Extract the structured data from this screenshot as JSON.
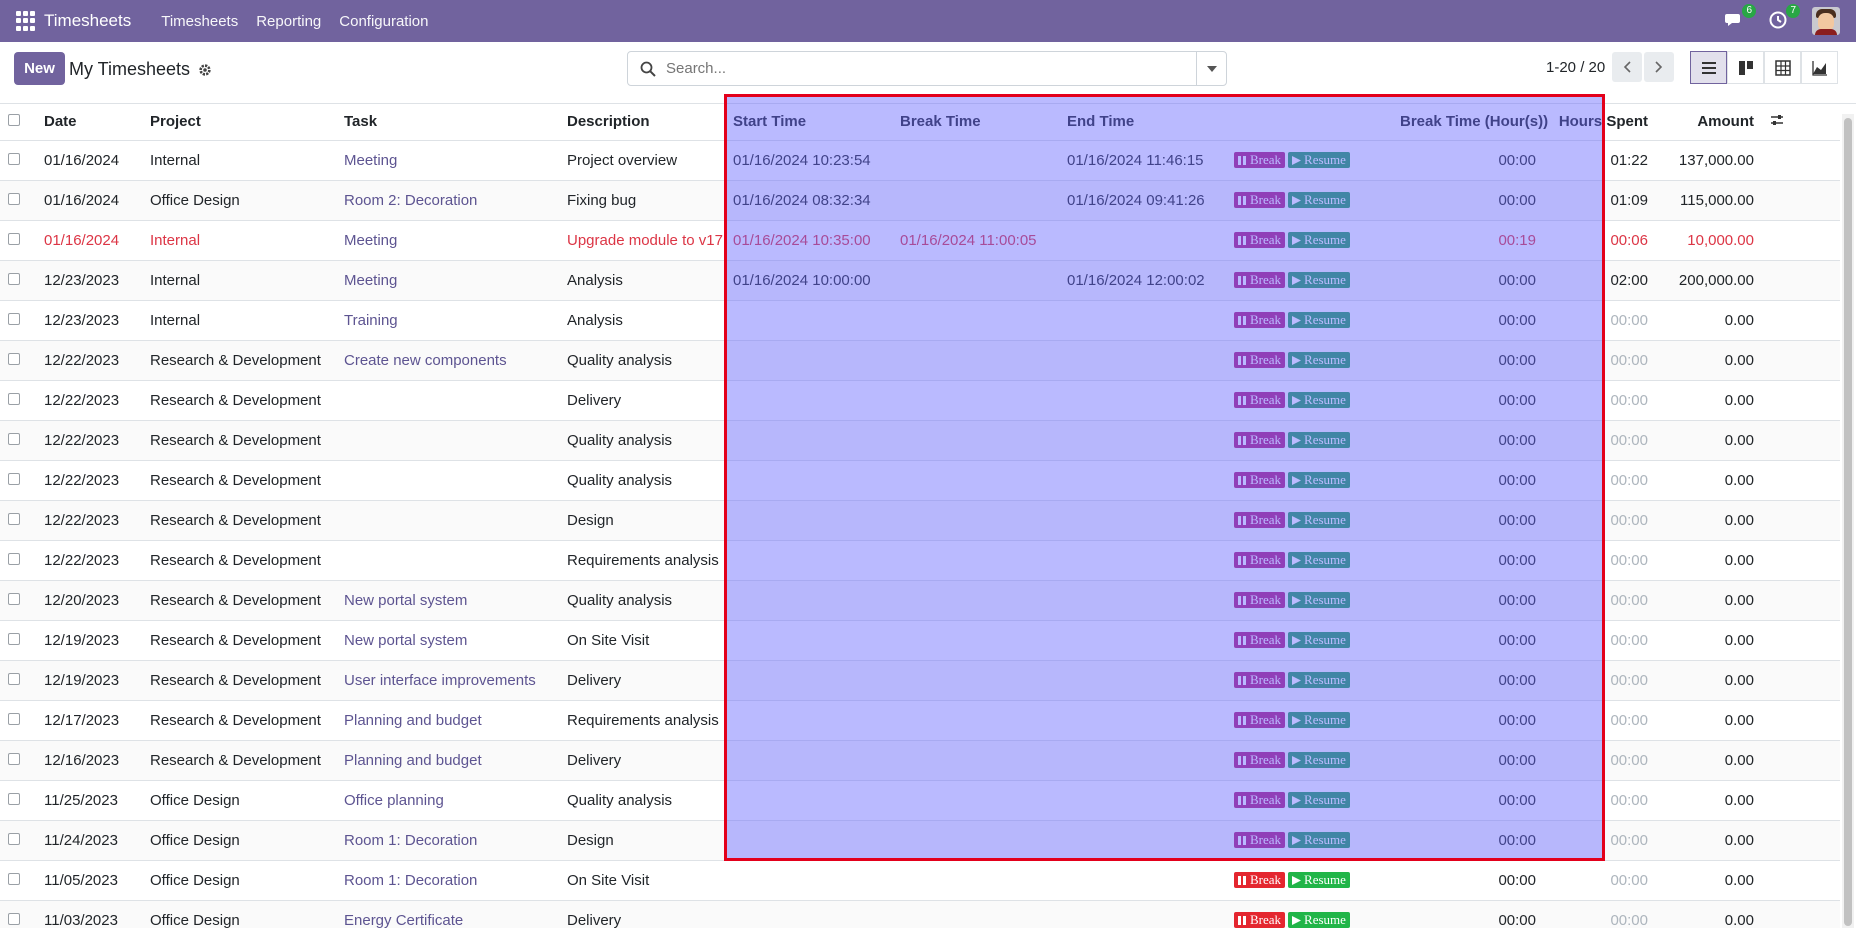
{
  "app": {
    "brand": "Timesheets",
    "menu": [
      "Timesheets",
      "Reporting",
      "Configuration"
    ],
    "messages_count": "6",
    "activities_count": "7"
  },
  "control": {
    "new_label": "New",
    "breadcrumb": "My Timesheets",
    "search_placeholder": "Search...",
    "pager": "1-20 / 20"
  },
  "table": {
    "headers": {
      "date": "Date",
      "project": "Project",
      "task": "Task",
      "description": "Description",
      "start_time": "Start Time",
      "break_time": "Break Time",
      "end_time": "End Time",
      "break_hours": "Break Time (Hour(s))",
      "hours_spent": "Hours Spent",
      "amount": "Amount"
    },
    "button_labels": {
      "break": "Break",
      "resume": "Resume"
    },
    "rows": [
      {
        "date": "01/16/2024",
        "project": "Internal",
        "task": "Meeting",
        "description": "Project overview",
        "start": "01/16/2024 10:23:54",
        "break": "",
        "end": "01/16/2024 11:46:15",
        "break_hours": "00:00",
        "hours": "01:22",
        "amount": "137,000.00"
      },
      {
        "date": "01/16/2024",
        "project": "Office Design",
        "task": "Room 2: Decoration",
        "description": "Fixing bug",
        "start": "01/16/2024 08:32:34",
        "break": "",
        "end": "01/16/2024 09:41:26",
        "break_hours": "00:00",
        "hours": "01:09",
        "amount": "115,000.00"
      },
      {
        "date": "01/16/2024",
        "project": "Internal",
        "task": "Meeting",
        "description": "Upgrade module to v17",
        "start": "01/16/2024 10:35:00",
        "break": "01/16/2024 11:00:05",
        "end": "",
        "break_hours": "00:19",
        "hours": "00:06",
        "amount": "10,000.00",
        "danger": true
      },
      {
        "date": "12/23/2023",
        "project": "Internal",
        "task": "Meeting",
        "description": "Analysis",
        "start": "01/16/2024 10:00:00",
        "break": "",
        "end": "01/16/2024 12:00:02",
        "break_hours": "00:00",
        "hours": "02:00",
        "amount": "200,000.00"
      },
      {
        "date": "12/23/2023",
        "project": "Internal",
        "task": "Training",
        "description": "Analysis",
        "start": "",
        "break": "",
        "end": "",
        "break_hours": "00:00",
        "hours": "00:00",
        "amount": "0.00",
        "zero": true
      },
      {
        "date": "12/22/2023",
        "project": "Research & Development",
        "task": "Create new components",
        "description": "Quality analysis",
        "start": "",
        "break": "",
        "end": "",
        "break_hours": "00:00",
        "hours": "00:00",
        "amount": "0.00",
        "zero": true
      },
      {
        "date": "12/22/2023",
        "project": "Research & Development",
        "task": "",
        "description": "Delivery",
        "start": "",
        "break": "",
        "end": "",
        "break_hours": "00:00",
        "hours": "00:00",
        "amount": "0.00",
        "zero": true
      },
      {
        "date": "12/22/2023",
        "project": "Research & Development",
        "task": "",
        "description": "Quality analysis",
        "start": "",
        "break": "",
        "end": "",
        "break_hours": "00:00",
        "hours": "00:00",
        "amount": "0.00",
        "zero": true
      },
      {
        "date": "12/22/2023",
        "project": "Research & Development",
        "task": "",
        "description": "Quality analysis",
        "start": "",
        "break": "",
        "end": "",
        "break_hours": "00:00",
        "hours": "00:00",
        "amount": "0.00",
        "zero": true
      },
      {
        "date": "12/22/2023",
        "project": "Research & Development",
        "task": "",
        "description": "Design",
        "start": "",
        "break": "",
        "end": "",
        "break_hours": "00:00",
        "hours": "00:00",
        "amount": "0.00",
        "zero": true
      },
      {
        "date": "12/22/2023",
        "project": "Research & Development",
        "task": "",
        "description": "Requirements analysis",
        "start": "",
        "break": "",
        "end": "",
        "break_hours": "00:00",
        "hours": "00:00",
        "amount": "0.00",
        "zero": true
      },
      {
        "date": "12/20/2023",
        "project": "Research & Development",
        "task": "New portal system",
        "description": "Quality analysis",
        "start": "",
        "break": "",
        "end": "",
        "break_hours": "00:00",
        "hours": "00:00",
        "amount": "0.00",
        "zero": true
      },
      {
        "date": "12/19/2023",
        "project": "Research & Development",
        "task": "New portal system",
        "description": "On Site Visit",
        "start": "",
        "break": "",
        "end": "",
        "break_hours": "00:00",
        "hours": "00:00",
        "amount": "0.00",
        "zero": true
      },
      {
        "date": "12/19/2023",
        "project": "Research & Development",
        "task": "User interface improvements",
        "description": "Delivery",
        "start": "",
        "break": "",
        "end": "",
        "break_hours": "00:00",
        "hours": "00:00",
        "amount": "0.00",
        "zero": true
      },
      {
        "date": "12/17/2023",
        "project": "Research & Development",
        "task": "Planning and budget",
        "description": "Requirements analysis",
        "start": "",
        "break": "",
        "end": "",
        "break_hours": "00:00",
        "hours": "00:00",
        "amount": "0.00",
        "zero": true
      },
      {
        "date": "12/16/2023",
        "project": "Research & Development",
        "task": "Planning and budget",
        "description": "Delivery",
        "start": "",
        "break": "",
        "end": "",
        "break_hours": "00:00",
        "hours": "00:00",
        "amount": "0.00",
        "zero": true
      },
      {
        "date": "11/25/2023",
        "project": "Office Design",
        "task": "Office planning",
        "description": "Quality analysis",
        "start": "",
        "break": "",
        "end": "",
        "break_hours": "00:00",
        "hours": "00:00",
        "amount": "0.00",
        "zero": true
      },
      {
        "date": "11/24/2023",
        "project": "Office Design",
        "task": "Room 1: Decoration",
        "description": "Design",
        "start": "",
        "break": "",
        "end": "",
        "break_hours": "00:00",
        "hours": "00:00",
        "amount": "0.00",
        "zero": true
      },
      {
        "date": "11/05/2023",
        "project": "Office Design",
        "task": "Room 1: Decoration",
        "description": "On Site Visit",
        "start": "",
        "break": "",
        "end": "",
        "break_hours": "00:00",
        "hours": "00:00",
        "amount": "0.00",
        "zero": true
      },
      {
        "date": "11/03/2023",
        "project": "Office Design",
        "task": "Energy Certificate",
        "description": "Delivery",
        "start": "",
        "break": "",
        "end": "",
        "break_hours": "00:00",
        "hours": "00:00",
        "amount": "0.00",
        "zero": true
      }
    ]
  },
  "colors": {
    "brand": "#71639e",
    "highlight_fill": "#6666ff",
    "highlight_border": "#e3001b",
    "break_button": "#b31f7e",
    "resume_button": "#23a05b",
    "danger_text": "#dc3545"
  }
}
